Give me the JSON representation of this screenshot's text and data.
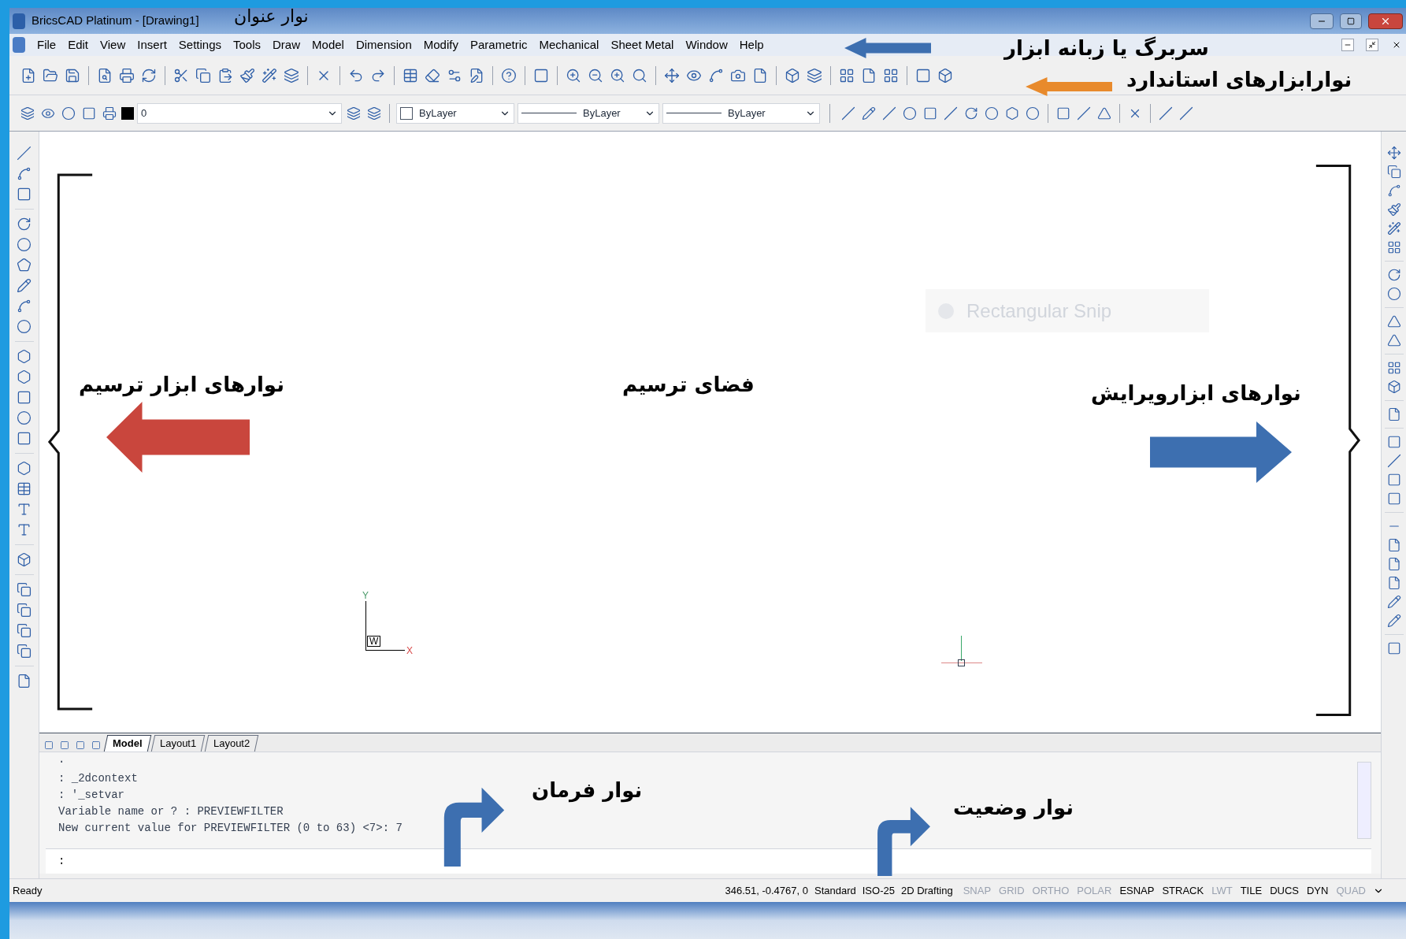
{
  "window": {
    "title": "BricsCAD Platinum - [Drawing1]"
  },
  "menu": [
    "File",
    "Edit",
    "View",
    "Insert",
    "Settings",
    "Tools",
    "Draw",
    "Model",
    "Dimension",
    "Modify",
    "Parametric",
    "Mechanical",
    "Sheet Metal",
    "Window",
    "Help"
  ],
  "layer_toolbar": {
    "layer": "0",
    "color_setting": "ByLayer",
    "linetype": "ByLayer",
    "lineweight": "ByLayer"
  },
  "drawing": {
    "ucs_y": "Y",
    "ucs_x": "X",
    "ucs_w": "W",
    "snip_overlay": "Rectangular Snip"
  },
  "layout_tabs": [
    {
      "label": "Model",
      "selected": true
    },
    {
      "label": "Layout1",
      "selected": false
    },
    {
      "label": "Layout2",
      "selected": false
    }
  ],
  "command_history": [
    "·",
    ": _2dcontext",
    ": '_setvar",
    "Variable name or ? : PREVIEWFILTER",
    "New current value for PREVIEWFILTER (0 to 63) <7>: 7"
  ],
  "command_prompt": ":",
  "status_bar": {
    "message": "Ready",
    "coordinates": "346.51, -0.4767, 0",
    "styles": [
      "Standard",
      "ISO-25",
      "2D Drafting"
    ],
    "toggles": [
      {
        "label": "SNAP",
        "on": false
      },
      {
        "label": "GRID",
        "on": false
      },
      {
        "label": "ORTHO",
        "on": false
      },
      {
        "label": "POLAR",
        "on": false
      },
      {
        "label": "ESNAP",
        "on": true
      },
      {
        "label": "STRACK",
        "on": true
      },
      {
        "label": "LWT",
        "on": false
      },
      {
        "label": "TILE",
        "on": true
      },
      {
        "label": "DUCS",
        "on": true
      },
      {
        "label": "DYN",
        "on": true
      },
      {
        "label": "QUAD",
        "on": false
      }
    ]
  },
  "annotations": {
    "title_bar": "نوار عنوان",
    "menu_bar": "سربرگ یا زبانه ابزار",
    "standard_toolbars": "نوارابزارهای استاندارد",
    "draw_toolbars": "نوارهای ابزار ترسیم",
    "drawing_area": "فضای ترسیم",
    "modify_toolbars": "نوارهای ابزارویرایش",
    "command_bar": "نوار فرمان",
    "status_bar": "نوار وضعیت"
  }
}
